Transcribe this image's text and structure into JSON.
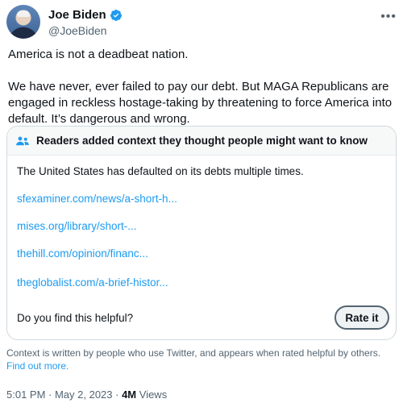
{
  "author": {
    "name": "Joe Biden",
    "handle": "@JoeBiden",
    "verified_color": "#1d9bf0"
  },
  "tweet": {
    "paragraph1": "America is not a deadbeat nation.",
    "paragraph2": "We have never, ever failed to pay our debt. But MAGA Republicans are engaged in reckless hostage-taking by threatening to force America into default. It’s dangerous and wrong."
  },
  "community_note": {
    "title": "Readers added context they thought people might want to know",
    "body": "The United States has defaulted on its debts multiple times.",
    "links": [
      "sfexaminer.com/news/a-short-h...",
      "mises.org/library/short-...",
      "thehill.com/opinion/financ...",
      "theglobalist.com/a-brief-histor..."
    ],
    "helpful_prompt": "Do you find this helpful?",
    "rate_label": "Rate it"
  },
  "disclaimer": {
    "text": "Context is written by people who use Twitter, and appears when rated helpful by others.",
    "find_out_more": "Find out more."
  },
  "meta": {
    "datetime": "5:01 PM · May 2, 2023 · ",
    "views_count": "4M",
    "views_label": " Views"
  },
  "icons": {
    "more": "more-icon",
    "verified": "verified-icon",
    "people": "people-icon"
  },
  "colors": {
    "link": "#1d9bf0",
    "muted": "#536471",
    "text": "#0f1419"
  }
}
